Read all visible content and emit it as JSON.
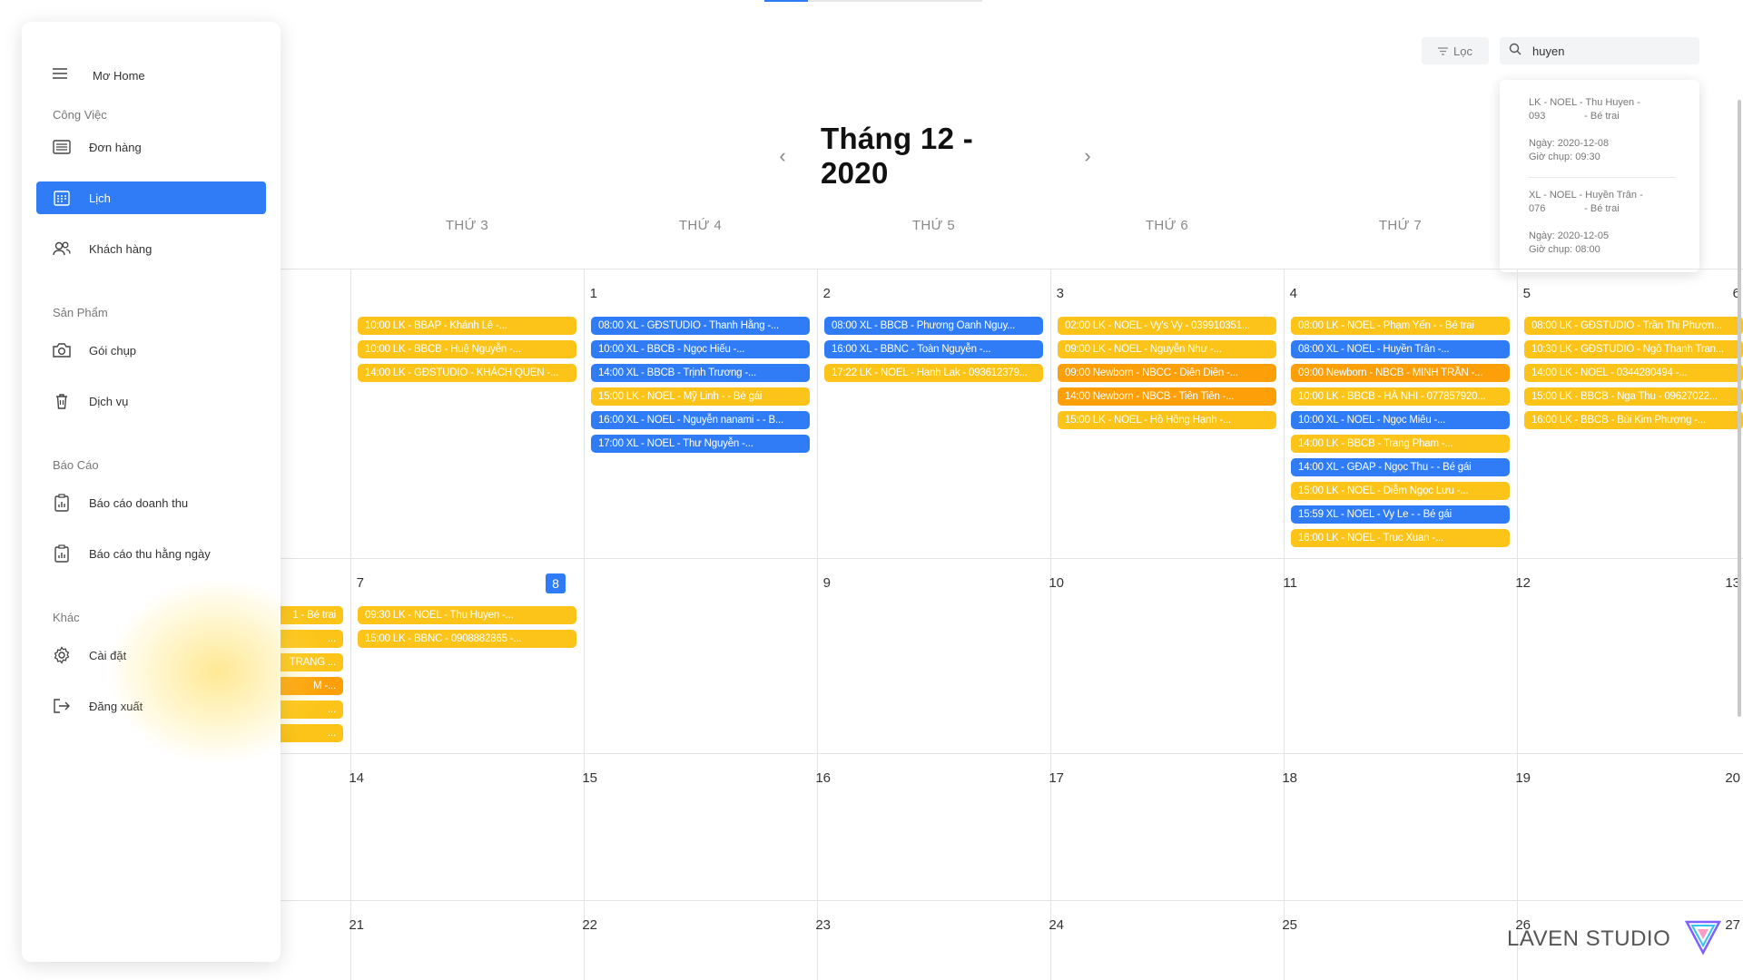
{
  "header": {
    "month_title": "Tháng 12 - 2020",
    "filter_label": "Lọc",
    "search_value": "huyen"
  },
  "search_results": [
    {
      "line1": "LK - NOEL - Thu Huyen -",
      "line2": "093              - Bé trai",
      "date": "Ngày: 2020-12-08",
      "time": "Giờ chụp: 09:30"
    },
    {
      "line1": "XL - NOEL - Huyền Trân -",
      "line2": "076              - Bé trai",
      "date": "Ngày: 2020-12-05",
      "time": "Giờ chụp: 08:00"
    }
  ],
  "sidebar": {
    "brand": "Mơ Home",
    "sections": {
      "work": "Công Việc",
      "products": "Sản Phẩm",
      "reports": "Báo Cáo",
      "other": "Khác"
    },
    "items": [
      {
        "label": "Đơn hàng"
      },
      {
        "label": "Lịch"
      },
      {
        "label": "Khách hàng"
      },
      {
        "label": "Gói chụp"
      },
      {
        "label": "Dịch vụ"
      },
      {
        "label": "Báo cáo doanh thu"
      },
      {
        "label": "Báo cáo thu hằng ngày"
      },
      {
        "label": "Cài đặt"
      },
      {
        "label": "Đăng xuất"
      }
    ]
  },
  "weekdays": [
    "THỨ 3",
    "THỨ 4",
    "THỨ 5",
    "THỨ 6",
    "THỨ 7"
  ],
  "days": {
    "w1": [
      "1",
      "2",
      "3",
      "4",
      "5",
      "6"
    ],
    "w2": [
      "7",
      "8",
      "9",
      "10",
      "11",
      "12",
      "13"
    ],
    "w3": [
      "14",
      "15",
      "16",
      "17",
      "18",
      "19",
      "20"
    ],
    "w4": [
      "21",
      "22",
      "23",
      "24",
      "25",
      "26",
      "27"
    ]
  },
  "events": {
    "d1": [
      "10:00 LK - BBAP - Khánh Lê -...",
      "10:00 LK - BBCB - Huệ Nguyễn -...",
      "14:00 LK - GĐSTUDIO - KHÁCH QUEN -..."
    ],
    "d2": [
      "08:00 XL - GĐSTUDIO - Thanh Hằng -...",
      "10:00 XL - BBCB - Ngọc Hiếu -...",
      "14:00 XL - BBCB - Trịnh Trương -...",
      "15:00 LK - NOEL - Mỹ Linh - - Bé gái",
      "16:00 XL - NOEL - Nguyễn nanami - - B...",
      "17:00 XL - NOEL - Thư Nguyễn -..."
    ],
    "d3": [
      "08:00 XL - BBCB - Phương Oanh Nguy...",
      "16:00 XL - BBNC - Toàn Nguyễn -...",
      "17:22 LK - NOEL - Hanh Lak - 093612379..."
    ],
    "d4": [
      "02:00 LK - NOEL - Vy's Vy - 039910351...",
      "09:00 LK - NOEL - Nguyễn Như -...",
      "09:00 Newborn - NBCC - Diên Diên -...",
      "14:00 Newborn - NBCB - Tiên Tiên -...",
      "15:00 LK - NOEL - Hồ Hồng Hạnh -..."
    ],
    "d5": [
      "08:00 LK - NOEL - Phạm Yến - - Bé trai",
      "08:00 XL - NOEL - Huyền Trân -...",
      "09:00 Newborn - NBCB - MINH TRẦN -...",
      "10:00 LK - BBCB - HÀ NHI - 077857920...",
      "10:00 XL - NOEL - Ngọc Miêu -...",
      "14:00 LK - BBCB - Trang Pham -...",
      "14:00 XL - GĐAP - Ngọc Thu - - Bé gái",
      "15:00 LK - NOEL - Diễm Ngọc Lưu -...",
      "15:59 XL - NOEL - Vy Le - - Bé gái",
      "16:00 LK - NOEL - Truc Xuan -..."
    ],
    "d6": [
      "08:00 LK - GĐSTUDIO - Trần Thị Phượn...",
      "10:30 LK - GĐSTUDIO - Ngô Thanh Tran...",
      "14:00 LK - NOEL - 0344280494 -...",
      "15:00 LK - BBCB - Nga Thu - 09627022...",
      "16:00 LK - BBCB - Bùi Kim Phượng -..."
    ],
    "d7": [
      "1 - Bé trai",
      "...",
      "TRANG ...",
      "M -...",
      "...",
      "..."
    ],
    "d8": [
      "09:30 LK - NOEL - Thu Huyen -...",
      "15:00 LK - BBNC - 0908882865 -..."
    ]
  },
  "watermark": "LAVEN STUDIO",
  "colors": {
    "accent": "#2f7cf6",
    "event_blue": "#2f7cf6",
    "event_yellow": "#fcc419",
    "event_orange": "#fd9f08"
  }
}
